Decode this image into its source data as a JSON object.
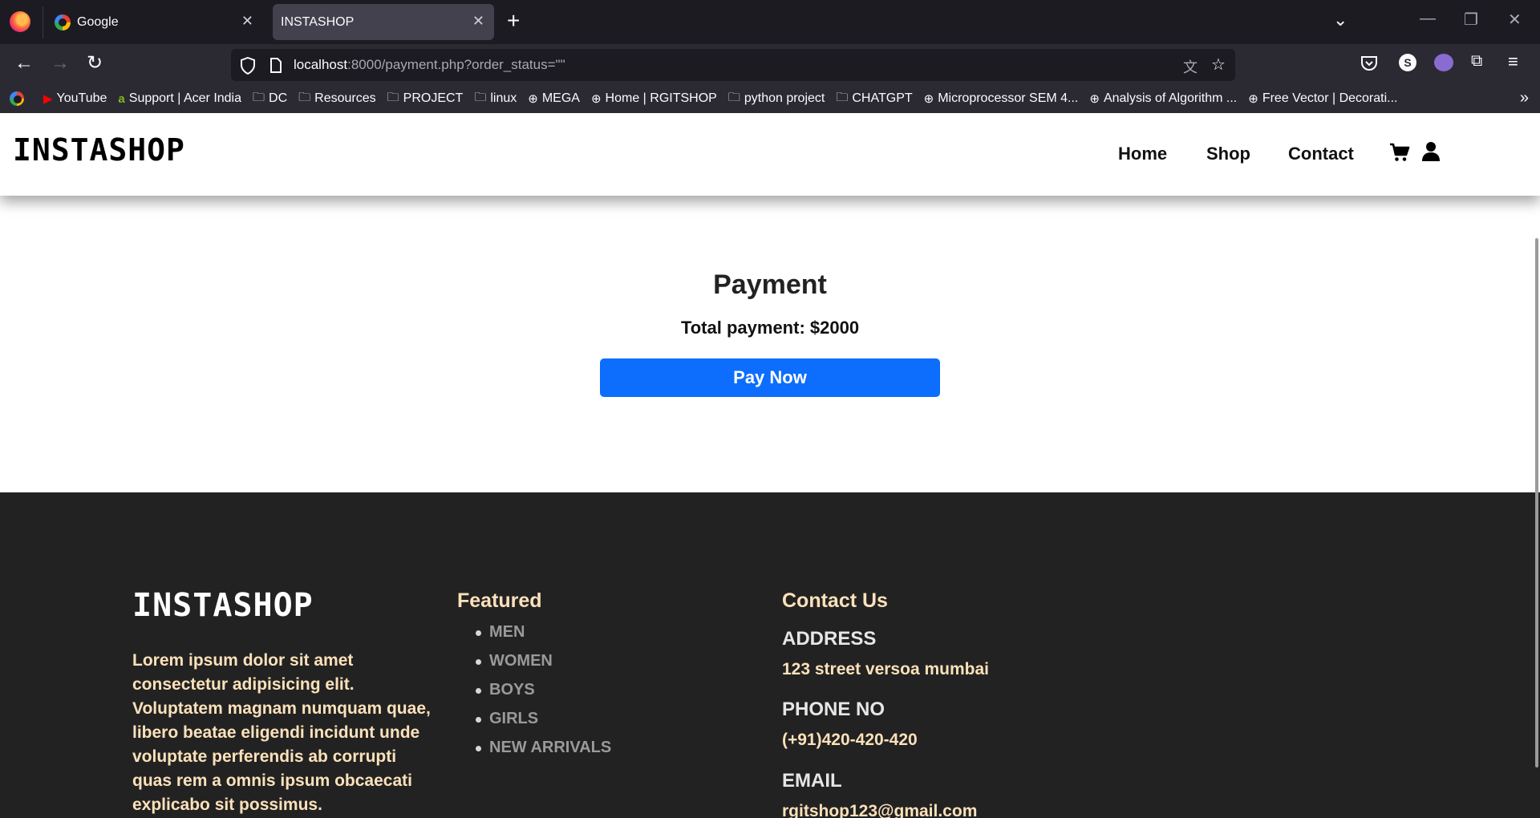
{
  "browser": {
    "tabs": [
      {
        "title": "Google"
      },
      {
        "title": "INSTASHOP"
      }
    ],
    "url": {
      "host": "localhost",
      "rest": ":8000/payment.php?order_status=\"\""
    },
    "bookmarks": [
      "YouTube",
      "Support | Acer India",
      "DC",
      "Resources",
      "PROJECT",
      "linux",
      "MEGA",
      "Home | RGITSHOP",
      "python project",
      "CHATGPT",
      "Microprocessor SEM 4...",
      "Analysis of Algorithm ...",
      "Free Vector | Decorati..."
    ]
  },
  "site": {
    "brand": "INSTASHOP",
    "menu": [
      "Home",
      "Shop",
      "Contact"
    ]
  },
  "payment": {
    "title": "Payment",
    "total": "Total payment: $2000",
    "button": "Pay Now",
    "accent": "#0d6efd"
  },
  "footer": {
    "brand": "INSTASHOP",
    "description": "Lorem ipsum dolor sit amet consectetur adipisicing elit. Voluptatem magnam numquam quae, libero beatae eligendi incidunt unde voluptate perferendis ab corrupti quas rem a omnis ipsum obcaecati explicabo sit possimus.",
    "featured_title": "Featured",
    "featured": [
      "MEN",
      "WOMEN",
      "BOYS",
      "GIRLS",
      "NEW ARRIVALS"
    ],
    "contact_title": "Contact Us",
    "address_label": "ADDRESS",
    "address": "123 street versoa mumbai",
    "phone_label": "PHONE NO",
    "phone": "(+91)420-420-420",
    "email_label": "EMAIL",
    "email": "rgitshop123@gmail.com"
  }
}
